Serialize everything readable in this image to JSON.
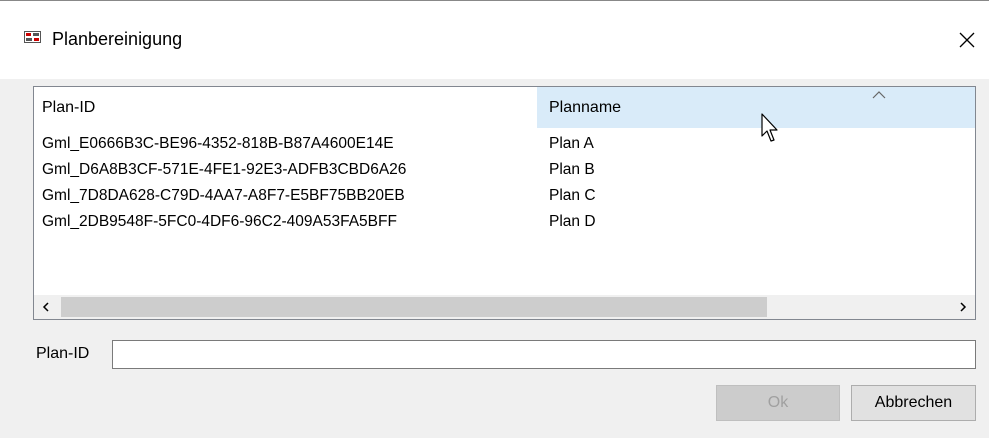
{
  "window": {
    "title": "Planbereinigung",
    "icon": "app-icon",
    "close_icon": "close-icon"
  },
  "list": {
    "columns": [
      "Plan-ID",
      "Planname"
    ],
    "sorted_column": "Planname",
    "rows": [
      {
        "id": "Gml_E0666B3C-BE96-4352-818B-B87A4600E14E",
        "name": "Plan A"
      },
      {
        "id": "Gml_D6A8B3CF-571E-4FE1-92E3-ADFB3CBD6A26",
        "name": "Plan B"
      },
      {
        "id": "Gml_7D8DA628-C79D-4AA7-A8F7-E5BF75BB20EB",
        "name": "Plan C"
      },
      {
        "id": "Gml_2DB9548F-5FC0-4DF6-96C2-409A53FA5BFF",
        "name": "Plan D"
      }
    ]
  },
  "form": {
    "label": "Plan-ID",
    "value": ""
  },
  "buttons": {
    "ok": "Ok",
    "cancel": "Abbrechen"
  },
  "colors": {
    "header_highlight": "#d9ebf9",
    "dialog_bg": "#f0f0f0"
  }
}
